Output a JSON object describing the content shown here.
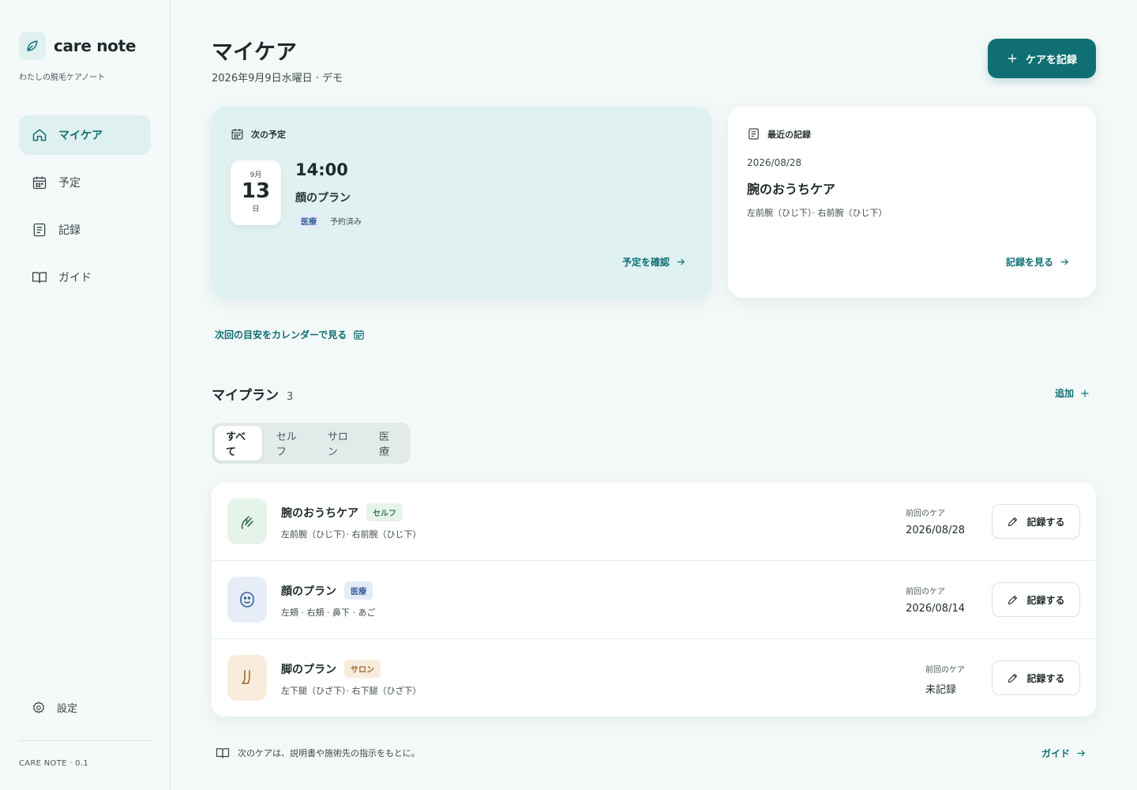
{
  "brand": {
    "name": "care note",
    "tagline": "わたしの脱毛ケアノート"
  },
  "nav": {
    "items": [
      {
        "label": "マイケア",
        "icon": "home-icon",
        "active": true
      },
      {
        "label": "予定",
        "icon": "calendar-icon"
      },
      {
        "label": "記録",
        "icon": "document-icon"
      },
      {
        "label": "ガイド",
        "icon": "book-icon"
      }
    ],
    "settings": "設定",
    "version": "CARE NOTE · 0.1"
  },
  "header": {
    "title": "マイケア",
    "date": "2026年9月9日水曜日 · デモ",
    "record_button": "ケアを記録"
  },
  "next": {
    "heading": "次の予定",
    "month": "9月",
    "day": "13",
    "weekday": "日",
    "time": "14:00",
    "plan": "顔のプラン",
    "tag": "医療",
    "status": "予約済み",
    "link": "予定を確認"
  },
  "recent": {
    "heading": "最近の記録",
    "date": "2026/08/28",
    "title": "腕のおうちケア",
    "areas": "左前腕（ひじ下）· 右前腕（ひじ下）",
    "link": "記録を見る"
  },
  "calendar_link": "次回の目安をカレンダーで見る",
  "plans": {
    "title": "マイプラン",
    "count": "3",
    "add": "追加",
    "filters": [
      "すべて",
      "セルフ",
      "サロン",
      "医療"
    ],
    "last_label": "前回のケア",
    "record_label": "記録する",
    "items": [
      {
        "name": "腕のおうちケア",
        "type": "セルフ",
        "areas": "左前腕（ひじ下）· 右前腕（ひじ下）",
        "last": "2026/08/28"
      },
      {
        "name": "顔のプラン",
        "type": "医療",
        "areas": "左頬 · 右頬 · 鼻下 · あご",
        "last": "2026/08/14"
      },
      {
        "name": "脚のプラン",
        "type": "サロン",
        "areas": "左下腿（ひざ下）· 右下腿（ひざ下）",
        "last": "未記録"
      }
    ]
  },
  "footer": {
    "note": "次のケアは、説明書や施術先の指示をもとに。",
    "guide": "ガイド"
  },
  "colors": {
    "accent": "#0f6f73",
    "background": "#f3f8f8",
    "card_tint": "#e0f1f1"
  }
}
